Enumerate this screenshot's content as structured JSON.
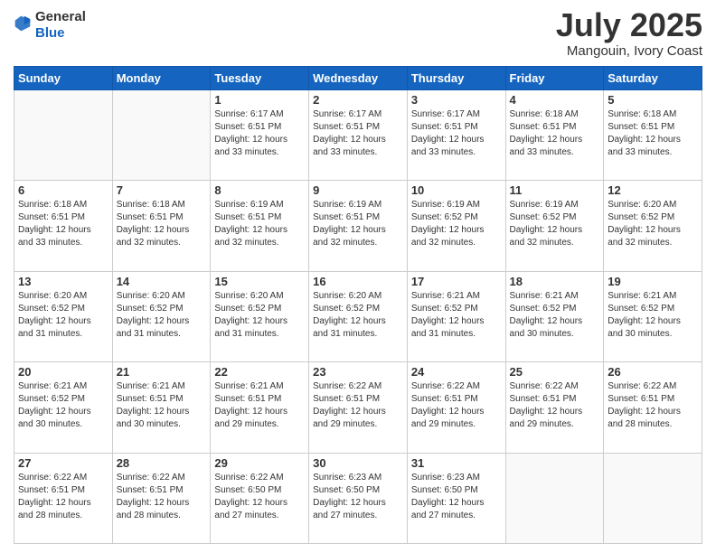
{
  "header": {
    "logo_general": "General",
    "logo_blue": "Blue",
    "month_title": "July 2025",
    "location": "Mangouin, Ivory Coast"
  },
  "weekdays": [
    "Sunday",
    "Monday",
    "Tuesday",
    "Wednesday",
    "Thursday",
    "Friday",
    "Saturday"
  ],
  "weeks": [
    [
      {
        "day": "",
        "empty": true
      },
      {
        "day": "",
        "empty": true
      },
      {
        "day": "1",
        "sunrise": "6:17 AM",
        "sunset": "6:51 PM",
        "daylight": "12 hours and 33 minutes."
      },
      {
        "day": "2",
        "sunrise": "6:17 AM",
        "sunset": "6:51 PM",
        "daylight": "12 hours and 33 minutes."
      },
      {
        "day": "3",
        "sunrise": "6:17 AM",
        "sunset": "6:51 PM",
        "daylight": "12 hours and 33 minutes."
      },
      {
        "day": "4",
        "sunrise": "6:18 AM",
        "sunset": "6:51 PM",
        "daylight": "12 hours and 33 minutes."
      },
      {
        "day": "5",
        "sunrise": "6:18 AM",
        "sunset": "6:51 PM",
        "daylight": "12 hours and 33 minutes."
      }
    ],
    [
      {
        "day": "6",
        "sunrise": "6:18 AM",
        "sunset": "6:51 PM",
        "daylight": "12 hours and 33 minutes."
      },
      {
        "day": "7",
        "sunrise": "6:18 AM",
        "sunset": "6:51 PM",
        "daylight": "12 hours and 32 minutes."
      },
      {
        "day": "8",
        "sunrise": "6:19 AM",
        "sunset": "6:51 PM",
        "daylight": "12 hours and 32 minutes."
      },
      {
        "day": "9",
        "sunrise": "6:19 AM",
        "sunset": "6:51 PM",
        "daylight": "12 hours and 32 minutes."
      },
      {
        "day": "10",
        "sunrise": "6:19 AM",
        "sunset": "6:52 PM",
        "daylight": "12 hours and 32 minutes."
      },
      {
        "day": "11",
        "sunrise": "6:19 AM",
        "sunset": "6:52 PM",
        "daylight": "12 hours and 32 minutes."
      },
      {
        "day": "12",
        "sunrise": "6:20 AM",
        "sunset": "6:52 PM",
        "daylight": "12 hours and 32 minutes."
      }
    ],
    [
      {
        "day": "13",
        "sunrise": "6:20 AM",
        "sunset": "6:52 PM",
        "daylight": "12 hours and 31 minutes."
      },
      {
        "day": "14",
        "sunrise": "6:20 AM",
        "sunset": "6:52 PM",
        "daylight": "12 hours and 31 minutes."
      },
      {
        "day": "15",
        "sunrise": "6:20 AM",
        "sunset": "6:52 PM",
        "daylight": "12 hours and 31 minutes."
      },
      {
        "day": "16",
        "sunrise": "6:20 AM",
        "sunset": "6:52 PM",
        "daylight": "12 hours and 31 minutes."
      },
      {
        "day": "17",
        "sunrise": "6:21 AM",
        "sunset": "6:52 PM",
        "daylight": "12 hours and 31 minutes."
      },
      {
        "day": "18",
        "sunrise": "6:21 AM",
        "sunset": "6:52 PM",
        "daylight": "12 hours and 30 minutes."
      },
      {
        "day": "19",
        "sunrise": "6:21 AM",
        "sunset": "6:52 PM",
        "daylight": "12 hours and 30 minutes."
      }
    ],
    [
      {
        "day": "20",
        "sunrise": "6:21 AM",
        "sunset": "6:52 PM",
        "daylight": "12 hours and 30 minutes."
      },
      {
        "day": "21",
        "sunrise": "6:21 AM",
        "sunset": "6:51 PM",
        "daylight": "12 hours and 30 minutes."
      },
      {
        "day": "22",
        "sunrise": "6:21 AM",
        "sunset": "6:51 PM",
        "daylight": "12 hours and 29 minutes."
      },
      {
        "day": "23",
        "sunrise": "6:22 AM",
        "sunset": "6:51 PM",
        "daylight": "12 hours and 29 minutes."
      },
      {
        "day": "24",
        "sunrise": "6:22 AM",
        "sunset": "6:51 PM",
        "daylight": "12 hours and 29 minutes."
      },
      {
        "day": "25",
        "sunrise": "6:22 AM",
        "sunset": "6:51 PM",
        "daylight": "12 hours and 29 minutes."
      },
      {
        "day": "26",
        "sunrise": "6:22 AM",
        "sunset": "6:51 PM",
        "daylight": "12 hours and 28 minutes."
      }
    ],
    [
      {
        "day": "27",
        "sunrise": "6:22 AM",
        "sunset": "6:51 PM",
        "daylight": "12 hours and 28 minutes."
      },
      {
        "day": "28",
        "sunrise": "6:22 AM",
        "sunset": "6:51 PM",
        "daylight": "12 hours and 28 minutes."
      },
      {
        "day": "29",
        "sunrise": "6:22 AM",
        "sunset": "6:50 PM",
        "daylight": "12 hours and 27 minutes."
      },
      {
        "day": "30",
        "sunrise": "6:23 AM",
        "sunset": "6:50 PM",
        "daylight": "12 hours and 27 minutes."
      },
      {
        "day": "31",
        "sunrise": "6:23 AM",
        "sunset": "6:50 PM",
        "daylight": "12 hours and 27 minutes."
      },
      {
        "day": "",
        "empty": true
      },
      {
        "day": "",
        "empty": true
      }
    ]
  ]
}
